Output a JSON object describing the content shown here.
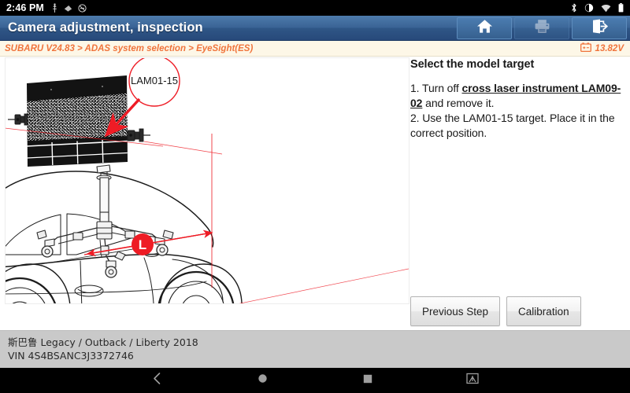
{
  "statusbar": {
    "clock": "2:46 PM",
    "left_icons": [
      "usb-icon",
      "vpn-key-icon",
      "do-not-disturb-icon"
    ],
    "right_icons": [
      "bluetooth-icon",
      "volume-icon",
      "wifi-icon",
      "battery-icon"
    ]
  },
  "titlebar": {
    "title": "Camera adjustment, inspection",
    "actions": [
      {
        "name": "home-button",
        "icon": "home-icon",
        "enabled": true
      },
      {
        "name": "print-button",
        "icon": "printer-icon",
        "enabled": false
      },
      {
        "name": "exit-button",
        "icon": "exit-icon",
        "enabled": true
      }
    ]
  },
  "breadcrumb": {
    "text": "SUBARU V24.83 > ADAS system selection > EyeSight(ES)",
    "voltage": "13.82V",
    "voltage_icon": "battery-icon"
  },
  "instructions": {
    "heading": "Select the model target",
    "step1_prefix": "1. Turn off ",
    "step1_emphasis": "cross laser instrument LAM09-02",
    "step1_suffix": " and remove it.",
    "step2": "2. Use the LAM01-15 target. Place it in the correct position."
  },
  "buttons": {
    "previous_step": "Previous Step",
    "calibration": "Calibration"
  },
  "diagram": {
    "callout_label": "LAM01-15",
    "dimension_label": "L",
    "accent_color": "#ee1c25"
  },
  "footer": {
    "vehicle": "斯巴鲁 Legacy / Outback / Liberty 2018",
    "vin": "VIN 4S4BSANC3J3372746"
  },
  "navbar": {
    "items": [
      {
        "name": "nav-back-button",
        "icon": "chevron-left-icon"
      },
      {
        "name": "nav-home-button",
        "icon": "circle-icon"
      },
      {
        "name": "nav-recents-button",
        "icon": "square-icon"
      },
      {
        "name": "nav-screenshot-button",
        "icon": "screenshot-icon"
      }
    ]
  },
  "colors": {
    "titlebar": "#36608f",
    "breadcrumb_text": "#f0743c",
    "accent": "#ee1c25",
    "footer_bg": "#c9c9c9"
  }
}
